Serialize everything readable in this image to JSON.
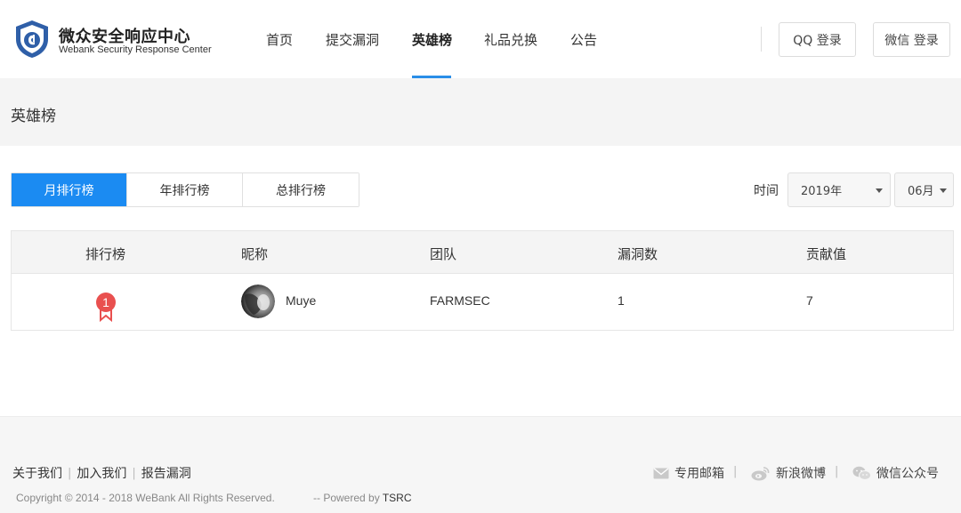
{
  "brand": {
    "name_cn": "微众安全响应中心",
    "name_en": "Webank Security Response Center"
  },
  "nav": {
    "items": [
      {
        "label": "首页"
      },
      {
        "label": "提交漏洞"
      },
      {
        "label": "英雄榜",
        "active": true
      },
      {
        "label": "礼品兑换"
      },
      {
        "label": "公告"
      }
    ]
  },
  "auth": {
    "qq_login": "QQ 登录",
    "wechat_login": "微信 登录"
  },
  "page": {
    "title": "英雄榜"
  },
  "tabs": [
    {
      "label": "月排行榜",
      "active": true
    },
    {
      "label": "年排行榜"
    },
    {
      "label": "总排行榜"
    }
  ],
  "filter": {
    "time_label": "时间",
    "year": "2019年",
    "month": "06月"
  },
  "table": {
    "headers": [
      "排行榜",
      "昵称",
      "团队",
      "漏洞数",
      "贡献值"
    ],
    "rows": [
      {
        "rank": "1",
        "nickname": "Muye",
        "team": "FARMSEC",
        "vulns": "1",
        "contribution": "7"
      }
    ]
  },
  "footer": {
    "links": [
      "关于我们",
      "加入我们",
      "报告漏洞"
    ],
    "copyright": "Copyright © 2014 - 2018 WeBank All Rights Reserved.",
    "powered_prefix": "-- Powered by",
    "powered_by": "TSRC",
    "social": [
      {
        "label": "专用邮箱",
        "icon": "mail-icon"
      },
      {
        "label": "新浪微博",
        "icon": "weibo-icon"
      },
      {
        "label": "微信公众号",
        "icon": "wechat-icon"
      }
    ]
  },
  "colors": {
    "accent": "#1b8bf2",
    "nav_underline": "#2a8ee8",
    "rank_badge": "#e9504f",
    "logo_blue": "#2f5fa8"
  }
}
